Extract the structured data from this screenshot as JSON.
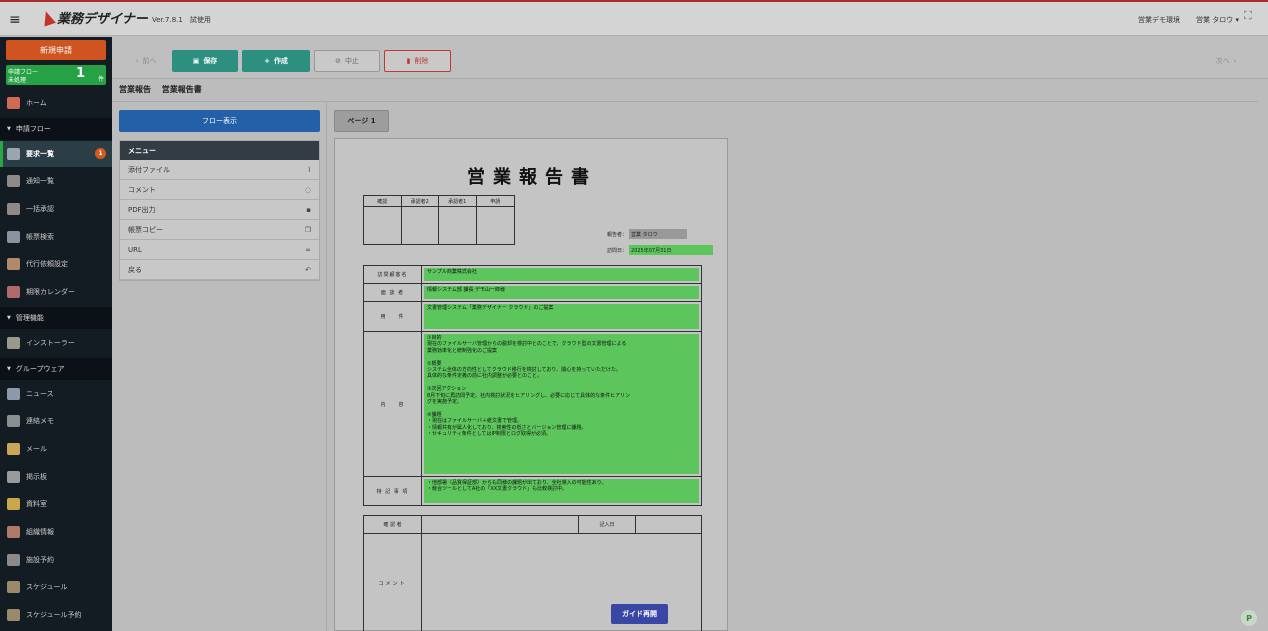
{
  "header": {
    "app_name": "業務デザイナー",
    "version": "Ver.7.8.1　試使用",
    "environment": "営業デモ環境",
    "user": "営業 タロウ ▾"
  },
  "sidebar": {
    "new_request": "新規申請",
    "flow_status": {
      "line1": "申請フロー",
      "line2": "未処理",
      "count": "1",
      "unit": "件"
    },
    "items": [
      {
        "label": "ホーム"
      },
      {
        "section": "申請フロー"
      },
      {
        "label": "要求一覧",
        "badge": "1"
      },
      {
        "label": "通知一覧"
      },
      {
        "label": "一括承認"
      },
      {
        "label": "帳票検索"
      },
      {
        "label": "代行依頼設定"
      },
      {
        "label": "期限カレンダー"
      },
      {
        "section": "管理機能"
      },
      {
        "label": "インストーラー"
      },
      {
        "section": "グループウェア"
      },
      {
        "label": "ニュース"
      },
      {
        "label": "連絡メモ"
      },
      {
        "label": "メール"
      },
      {
        "label": "掲示板"
      },
      {
        "label": "資料室"
      },
      {
        "label": "組織情報"
      },
      {
        "label": "施設予約"
      },
      {
        "label": "スケジュール"
      },
      {
        "label": "スケジュール予約"
      }
    ]
  },
  "toolbar": {
    "prev": "前へ",
    "save": "保存",
    "create": "作成",
    "cancel": "中止",
    "delete": "削除",
    "next": "次へ"
  },
  "breadcrumb": {
    "category": "営業報告",
    "form": "営業報告書"
  },
  "left_panel": {
    "flow_button": "フロー表示",
    "menu_title": "メニュー",
    "menu_items": [
      "添付ファイル",
      "コメント",
      "PDF出力",
      "帳票コピー",
      "URL",
      "戻る"
    ]
  },
  "page_tab": "ページ 1",
  "document": {
    "title": "営業報告書",
    "approval_headers": [
      "確認",
      "承認者2",
      "承認者1",
      "申請"
    ],
    "reporter_label": "報告者：",
    "reporter_value": "営業 タロウ",
    "visit_date_label": "訪問日：",
    "visit_date_value": "2025年07月31日",
    "fields": [
      {
        "label": "訪問顧客名",
        "value": "サンプル商業株式会社"
      },
      {
        "label": "面 談 者",
        "value": "情報システム部 課長 デモ山一郎様"
      },
      {
        "label": "用　　件",
        "value": "文書管理システム「業務デザイナー クラウド」のご提案"
      },
      {
        "label": "内　　容",
        "value": "①目的\n現在のファイルサーバ管理からの脱却を検討中とのことで、クラウド型の文書管理による\n業務効率化と統制強化のご提案\n\n②概要\nシステム全体の方向性としてクラウド移行を検討しており、関心を持っていただけた。\n具体的な条件定義の前に社内調整が必要とのこと。\n\n③次回アクション\n8月下旬に再訪問予定。社内検討状況をヒアリングし、必要に応じて具体的な条件ヒアリン\nグを実施予定。\n\n④課題\n・現在はファイルサーバ＋紙文書で管理。\n・情報共有が属人化しており、検索性の低さとバージョン管理に課題。\n・セキュリティ条件としてはIP制限とログ取得が必須。"
      },
      {
        "label": "特 記 事 項",
        "value": "・他部署（品質保証部）からも同様の課題が出ており、全社導入の可能性あり。\n・競合ツールとしてA社の「XX文書クラウド」も比較検討中。"
      }
    ],
    "comment_headers": {
      "confirmer": "確 認 者",
      "entry_date": "記入日"
    },
    "comment_label": "コメント"
  },
  "guide_button": "ガイド再開",
  "colors": {
    "accent_teal": "#2c8f80",
    "new_request_orange": "#cf5420",
    "flow_green": "#26a244",
    "field_green": "#5cc55c",
    "flow_blue": "#2460a7",
    "guide_blue": "#3a46a4"
  }
}
